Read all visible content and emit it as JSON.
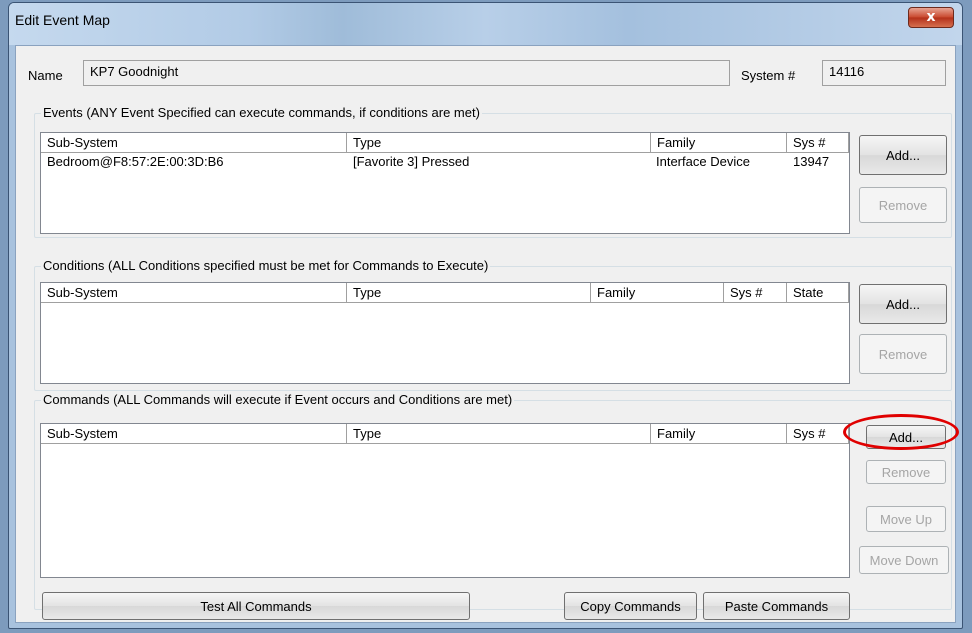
{
  "window": {
    "title": "Edit Event Map",
    "close_glyph": "x"
  },
  "name_label": "Name",
  "name_value": "KP7 Goodnight",
  "system_label": "System #",
  "system_value": "14116",
  "events": {
    "title": "Events (ANY Event Specified can execute commands, if conditions are met)",
    "columns": [
      "Sub-System",
      "Type",
      "Family",
      "Sys #"
    ],
    "rows": [
      {
        "subsystem": "Bedroom@F8:57:2E:00:3D:B6",
        "type": "[Favorite 3] Pressed",
        "family": "Interface Device",
        "sys": "13947"
      }
    ],
    "add_label": "Add...",
    "remove_label": "Remove"
  },
  "conditions": {
    "title": "Conditions (ALL Conditions specified must be met for Commands to Execute)",
    "columns": [
      "Sub-System",
      "Type",
      "Family",
      "Sys #",
      "State"
    ],
    "add_label": "Add...",
    "remove_label": "Remove"
  },
  "commands": {
    "title": "Commands (ALL Commands will execute if Event occurs and Conditions are met)",
    "columns": [
      "Sub-System",
      "Type",
      "Family",
      "Sys #"
    ],
    "add_label": "Add...",
    "remove_label": "Remove",
    "move_up_label": "Move Up",
    "move_down_label": "Move Down"
  },
  "footer": {
    "test_all": "Test All Commands",
    "copy": "Copy Commands",
    "paste": "Paste Commands"
  },
  "colors": {
    "highlight": "#e00000"
  }
}
